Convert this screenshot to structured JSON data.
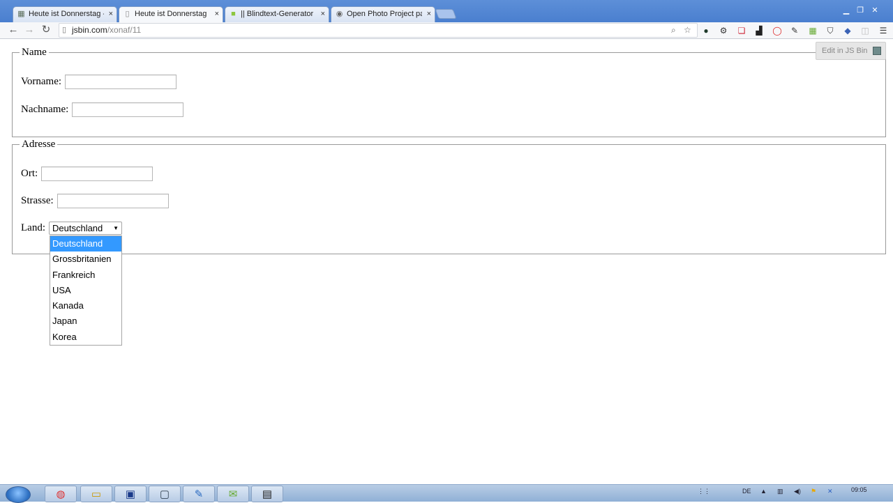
{
  "browser": {
    "tabs": [
      {
        "title": "Heute ist Donnerstag - JS Bin",
        "active": false,
        "icon": "jsbin-favicon"
      },
      {
        "title": "Heute ist Donnerstag",
        "active": true,
        "icon": "page-icon"
      },
      {
        "title": "|| Blindtext-Generator | Lorem ipsum",
        "active": false,
        "icon": "blindtext-favicon"
      },
      {
        "title": "Open Photo Project paper",
        "active": false,
        "icon": "openphoto-favicon"
      }
    ],
    "close_glyph": "×",
    "address": {
      "host": "jsbin.com",
      "path": "/xonaf/11"
    }
  },
  "page": {
    "edit_button": "Edit in JS Bin",
    "fieldset_name": {
      "legend": "Name",
      "vorname_label": "Vorname:",
      "vorname_value": "",
      "nachname_label": "Nachname:",
      "nachname_value": ""
    },
    "fieldset_address": {
      "legend": "Adresse",
      "ort_label": "Ort:",
      "ort_value": "",
      "strasse_label": "Strasse:",
      "strasse_value": "",
      "land_label": "Land:",
      "land_selected": "Deutschland",
      "land_options": [
        "Deutschland",
        "Grossbritanien",
        "Frankreich",
        "USA",
        "Kanada",
        "Japan",
        "Korea"
      ]
    }
  },
  "taskbar": {
    "language": "DE",
    "time": "09:05"
  },
  "colors": {
    "selection": "#3399ff",
    "tabstrip": "#4a7fcf"
  }
}
